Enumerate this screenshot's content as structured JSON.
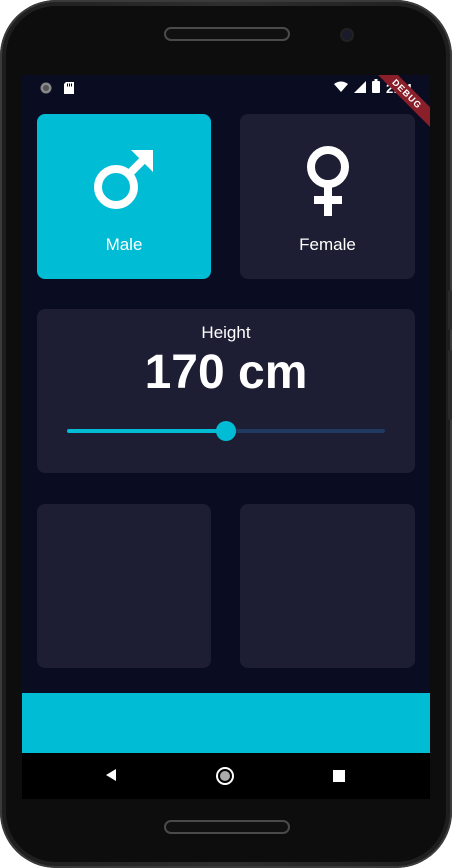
{
  "status_bar": {
    "time": "2:44",
    "debug_banner": "DEBUG"
  },
  "gender": {
    "male": {
      "label": "Male",
      "icon": "male-symbol-icon",
      "selected": true
    },
    "female": {
      "label": "Female",
      "icon": "female-symbol-icon",
      "selected": false
    }
  },
  "height": {
    "label": "Height",
    "value_text": "170 cm",
    "value": 170,
    "slider_fraction": 0.5
  },
  "colors": {
    "background": "#0a0d22",
    "card": "#1d1e33",
    "accent": "#00bcd4",
    "track_inactive": "#1e3a5f",
    "text": "#ffffff"
  },
  "nav": {
    "back": "back-icon",
    "home": "home-icon",
    "recents": "recents-icon"
  }
}
